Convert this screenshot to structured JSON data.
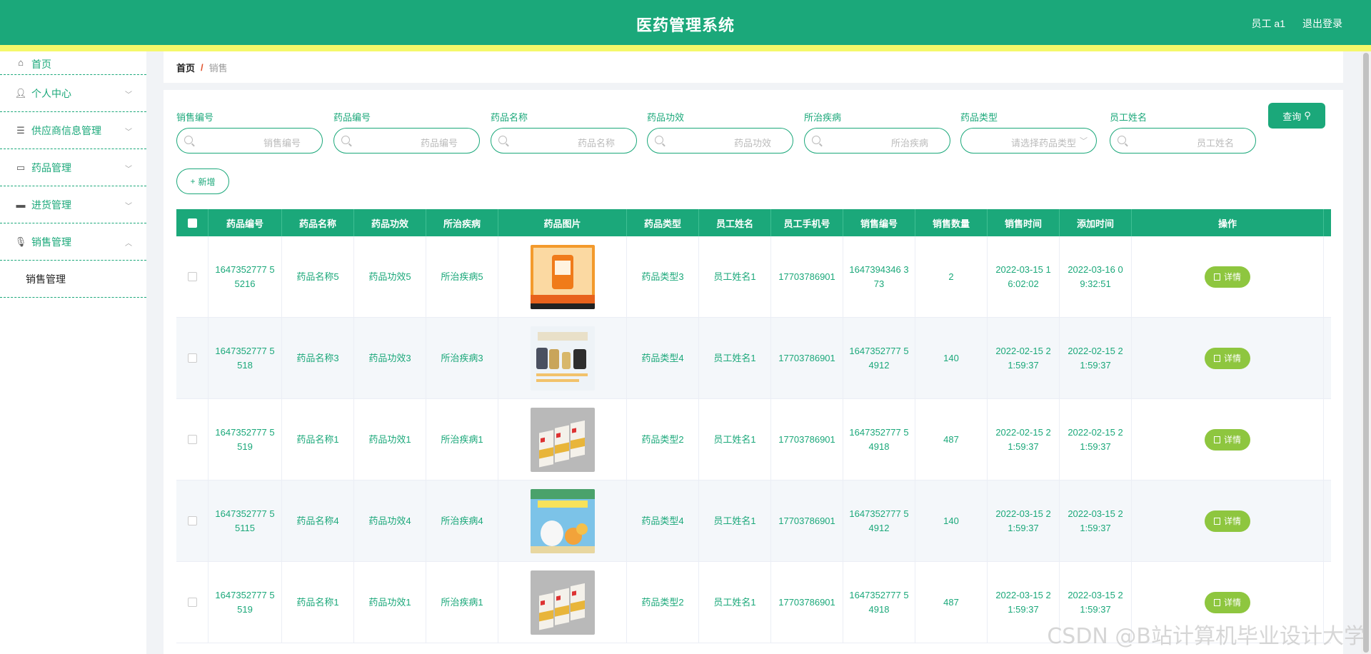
{
  "header": {
    "title": "医药管理系统",
    "user": "员工 a1",
    "logout": "退出登录"
  },
  "sidebar": {
    "items": [
      {
        "label": "首页",
        "icon": "home-icon"
      },
      {
        "label": "个人中心",
        "icon": "user-icon"
      },
      {
        "label": "供应商信息管理",
        "icon": "list-icon"
      },
      {
        "label": "药品管理",
        "icon": "card-icon"
      },
      {
        "label": "进货管理",
        "icon": "ticket-icon"
      },
      {
        "label": "销售管理",
        "icon": "mic-icon"
      }
    ],
    "submenu": "销售管理"
  },
  "breadcrumb": {
    "home": "首页",
    "sep": "/",
    "current": "销售"
  },
  "filters": [
    {
      "label": "销售编号",
      "placeholder": "销售编号"
    },
    {
      "label": "药品编号",
      "placeholder": "药品编号"
    },
    {
      "label": "药品名称",
      "placeholder": "药品名称"
    },
    {
      "label": "药品功效",
      "placeholder": "药品功效"
    },
    {
      "label": "所治疾病",
      "placeholder": "所治疾病"
    },
    {
      "label": "药品类型",
      "placeholder": "请选择药品类型"
    },
    {
      "label": "员工姓名",
      "placeholder": "员工姓名"
    }
  ],
  "buttons": {
    "query": "查询",
    "add": "新增",
    "detail": "详情"
  },
  "table": {
    "headers": [
      "药品编号",
      "药品名称",
      "药品功效",
      "所治疾病",
      "药品图片",
      "药品类型",
      "员工姓名",
      "员工手机号",
      "销售编号",
      "销售数量",
      "销售时间",
      "添加时间",
      "操作"
    ],
    "rows": [
      {
        "drug_id": "1647352777 55216",
        "name": "药品名称5",
        "effect": "药品功效5",
        "disease": "所治疾病5",
        "type": "药品类型3",
        "employee": "员工姓名1",
        "phone": "17703786901",
        "sale_id": "1647394346 373",
        "qty": "2",
        "sale_time": "2022-03-15 16:02:02",
        "add_time": "2022-03-16 09:32:51",
        "image": "orange-pill-box"
      },
      {
        "drug_id": "1647352777 5518",
        "name": "药品名称3",
        "effect": "药品功效3",
        "disease": "所治疾病3",
        "type": "药品类型4",
        "employee": "员工姓名1",
        "phone": "17703786901",
        "sale_id": "1647352777 54912",
        "qty": "140",
        "sale_time": "2022-02-15 21:59:37",
        "add_time": "2022-02-15 21:59:37",
        "image": "supplement-bottles"
      },
      {
        "drug_id": "1647352777 5519",
        "name": "药品名称1",
        "effect": "药品功效1",
        "disease": "所治疾病1",
        "type": "药品类型2",
        "employee": "员工姓名1",
        "phone": "17703786901",
        "sale_id": "1647352777 54918",
        "qty": "487",
        "sale_time": "2022-02-15 21:59:37",
        "add_time": "2022-02-15 21:59:37",
        "image": "medicine-boxes"
      },
      {
        "drug_id": "1647352777 55115",
        "name": "药品名称4",
        "effect": "药品功效4",
        "disease": "所治疾病4",
        "type": "药品类型4",
        "employee": "员工姓名1",
        "phone": "17703786901",
        "sale_id": "1647352777 54912",
        "qty": "140",
        "sale_time": "2022-03-15 21:59:37",
        "add_time": "2022-03-15 21:59:37",
        "image": "vitamin-c-jar"
      },
      {
        "drug_id": "1647352777 5519",
        "name": "药品名称1",
        "effect": "药品功效1",
        "disease": "所治疾病1",
        "type": "药品类型2",
        "employee": "员工姓名1",
        "phone": "17703786901",
        "sale_id": "1647352777 54918",
        "qty": "487",
        "sale_time": "2022-03-15 21:59:37",
        "add_time": "2022-03-15 21:59:37",
        "image": "medicine-boxes"
      }
    ]
  },
  "watermark": "CSDN @B站计算机毕业设计大学",
  "colors": {
    "primary": "#1ba87a",
    "accent_bar": "#f5f86a",
    "detail_button": "#8ec63f"
  }
}
